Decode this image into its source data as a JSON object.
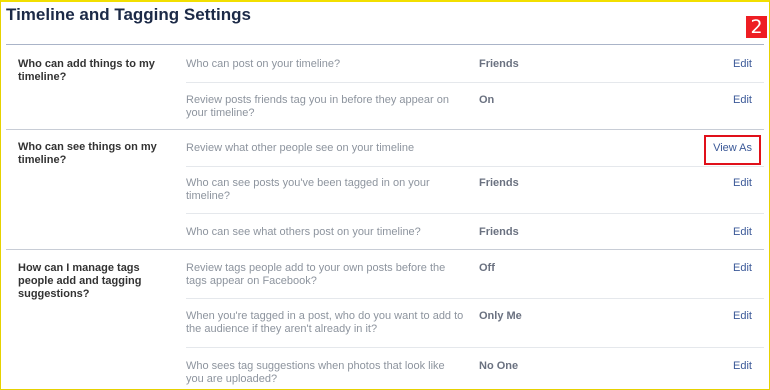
{
  "header": {
    "title": "Timeline and Tagging Settings",
    "step_number": "2"
  },
  "sections": [
    {
      "label": "Who can add things to my timeline?",
      "rows": [
        {
          "description": "Who can post on your timeline?",
          "value": "Friends",
          "action": "Edit"
        },
        {
          "description": "Review posts friends tag you in before they appear on your timeline?",
          "value": "On",
          "action": "Edit"
        }
      ]
    },
    {
      "label": "Who can see things on my timeline?",
      "rows": [
        {
          "description": "Review what other people see on your timeline",
          "value": "",
          "action": "View As"
        },
        {
          "description": "Who can see posts you've been tagged in on your timeline?",
          "value": "Friends",
          "action": "Edit"
        },
        {
          "description": "Who can see what others post on your timeline?",
          "value": "Friends",
          "action": "Edit"
        }
      ]
    },
    {
      "label": "How can I manage tags people add and tagging suggestions?",
      "rows": [
        {
          "description": "Review tags people add to your own posts before the tags appear on Facebook?",
          "value": "Off",
          "action": "Edit"
        },
        {
          "description": "When you're tagged in a post, who do you want to add to the audience if they aren't already in it?",
          "value": "Only Me",
          "action": "Edit"
        },
        {
          "description": "Who sees tag suggestions when photos that look like you are uploaded?",
          "value": "No One",
          "action": "Edit"
        }
      ]
    }
  ],
  "colors": {
    "title": "#1c2a47",
    "link": "#3b5998",
    "badge": "#ee1d23",
    "highlight": "#e0101a",
    "frame": "#f2df00"
  }
}
